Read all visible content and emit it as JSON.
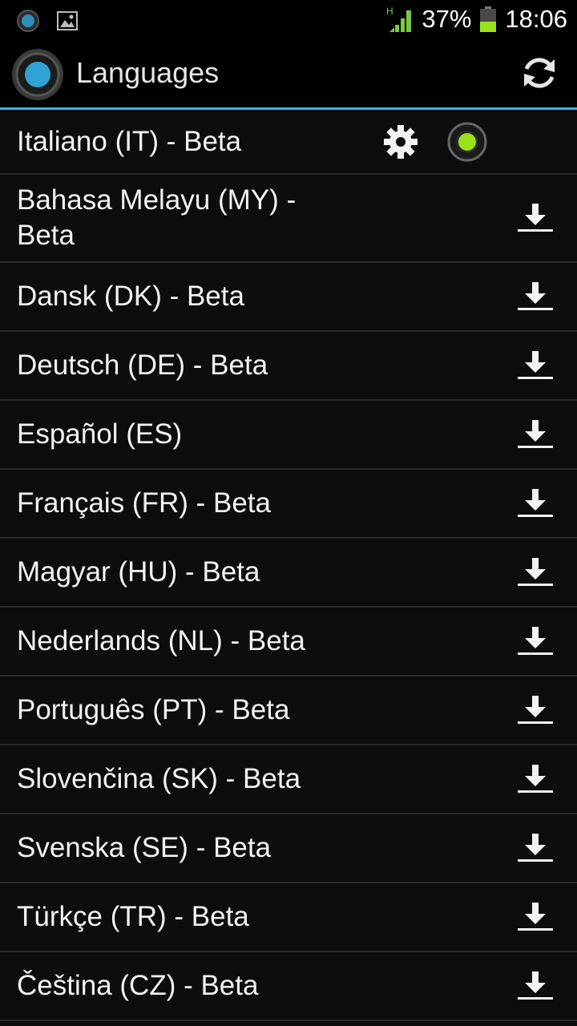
{
  "status_bar": {
    "network_type": "H",
    "battery_percent": "37%",
    "time": "18:06",
    "icons": [
      "app-notification-icon",
      "image-notification-icon",
      "signal-icon",
      "battery-icon"
    ]
  },
  "action_bar": {
    "title": "Languages",
    "icons": [
      "app-logo-icon",
      "refresh-icon"
    ]
  },
  "languages": [
    {
      "label": "Italiano (IT) - Beta",
      "state": "installed-selected"
    },
    {
      "label": "Bahasa Melayu (MY) - Beta",
      "state": "download"
    },
    {
      "label": "Dansk (DK) - Beta",
      "state": "download"
    },
    {
      "label": "Deutsch (DE) - Beta",
      "state": "download"
    },
    {
      "label": "Español (ES)",
      "state": "download"
    },
    {
      "label": "Français (FR) - Beta",
      "state": "download"
    },
    {
      "label": "Magyar (HU) - Beta",
      "state": "download"
    },
    {
      "label": "Nederlands (NL) - Beta",
      "state": "download"
    },
    {
      "label": "Português (PT) - Beta",
      "state": "download"
    },
    {
      "label": "Slovenčina (SK) - Beta",
      "state": "download"
    },
    {
      "label": "Svenska (SE) - Beta",
      "state": "download"
    },
    {
      "label": "Türkçe (TR) - Beta",
      "state": "download"
    },
    {
      "label": "Čeština (CZ) - Beta",
      "state": "download"
    }
  ],
  "colors": {
    "accent": "#33b5e5",
    "selected_radio": "#9ae21a",
    "signal": "#7ac943",
    "battery": "#9ae21a"
  }
}
